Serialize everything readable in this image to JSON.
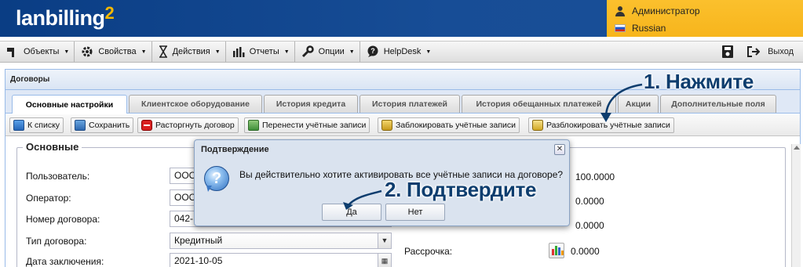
{
  "header": {
    "logo": "lanbilling",
    "logo_sup": "2",
    "user": "Администратор",
    "language": "Russian"
  },
  "menu": {
    "items": [
      {
        "label": "Объекты",
        "icon": "hammer-icon"
      },
      {
        "label": "Свойства",
        "icon": "gear-icon"
      },
      {
        "label": "Действия",
        "icon": "hourglass-icon"
      },
      {
        "label": "Отчеты",
        "icon": "bar-chart-icon"
      },
      {
        "label": "Опции",
        "icon": "wrench-icon"
      },
      {
        "label": "HelpDesk",
        "icon": "speech-bubble-icon"
      }
    ],
    "exit_label": "Выход"
  },
  "panel": {
    "title": "Договоры",
    "tabs": [
      "Основные настройки",
      "Клиентское оборудование",
      "История кредита",
      "История платежей",
      "История обещанных платежей",
      "Акции",
      "Дополнительные поля"
    ],
    "toolbar": [
      "К списку",
      "Сохранить",
      "Расторгнуть договор",
      "Перенести учётные записи",
      "Заблокировать учётные записи",
      "Разблокировать учётные записи"
    ]
  },
  "form": {
    "legend": "Основные",
    "fields": [
      {
        "label": "Пользователь:",
        "value": "ООО"
      },
      {
        "label": "Оператор:",
        "value": "ООО"
      },
      {
        "label": "Номер договора:",
        "value": "042-"
      },
      {
        "label": "Тип договора:",
        "value": "Кредитный"
      },
      {
        "label": "Дата заключения:",
        "value": "2021-10-05"
      }
    ],
    "right_values": [
      "100.0000",
      "0.0000",
      "0.0000"
    ],
    "installment_label": "Рассрочка:",
    "installment_value": "0.0000"
  },
  "dialog": {
    "title": "Подтверждение",
    "message": "Вы действительно хотите активировать все учётные записи на договоре?",
    "yes": "Да",
    "no": "Нет"
  },
  "annotations": {
    "step1": "1. Нажмите",
    "step2": "2. Подтвердите"
  },
  "colors": {
    "header_blue": "#0a3d84",
    "user_panel": "#f7b51c",
    "annotation": "#0d3d6e",
    "logo_accent": "#f5b800"
  }
}
